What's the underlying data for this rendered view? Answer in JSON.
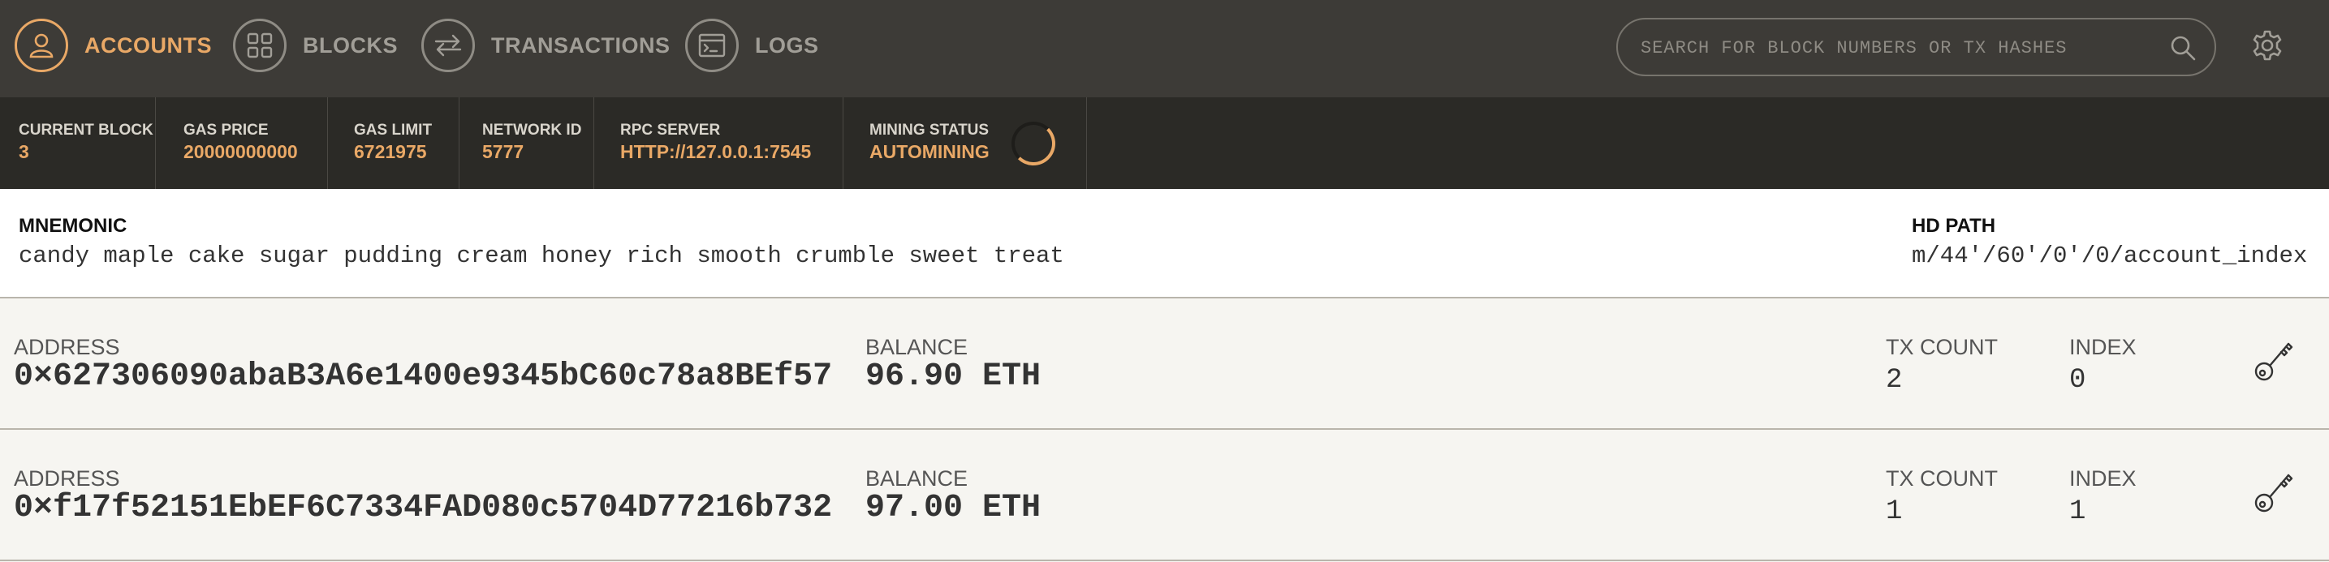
{
  "colors": {
    "accent": "#e9a866",
    "topbar": "#3d3b37",
    "statusbar": "#2b2a26",
    "background": "#f6f5f1"
  },
  "nav": [
    {
      "label": "ACCOUNTS",
      "icon": "person-icon",
      "active": true
    },
    {
      "label": "BLOCKS",
      "icon": "grid-icon",
      "active": false
    },
    {
      "label": "TRANSACTIONS",
      "icon": "arrows-swap-icon",
      "active": false
    },
    {
      "label": "LOGS",
      "icon": "terminal-icon",
      "active": false
    }
  ],
  "search": {
    "placeholder": "SEARCH FOR BLOCK NUMBERS OR TX HASHES",
    "value": ""
  },
  "status": {
    "current_block": {
      "label": "CURRENT BLOCK",
      "value": "3"
    },
    "gas_price": {
      "label": "GAS PRICE",
      "value": "20000000000"
    },
    "gas_limit": {
      "label": "GAS LIMIT",
      "value": "6721975"
    },
    "network_id": {
      "label": "NETWORK ID",
      "value": "5777"
    },
    "rpc_server": {
      "label": "RPC SERVER",
      "value": "HTTP://127.0.0.1:7545"
    },
    "mining_status": {
      "label": "MINING STATUS",
      "value": "AUTOMINING"
    }
  },
  "mnemonic": {
    "label": "MNEMONIC",
    "value": "candy maple cake sugar pudding cream honey rich smooth crumble sweet treat",
    "hd_path_label": "HD PATH",
    "hd_path_value": "m/44'/60'/0'/0/account_index"
  },
  "accounts": [
    {
      "address_label": "ADDRESS",
      "address": "0×627306090abaB3A6e1400e9345bC60c78a8BEf57",
      "balance_label": "BALANCE",
      "balance": "96.90 ETH",
      "tx_count_label": "TX COUNT",
      "tx_count": "2",
      "index_label": "INDEX",
      "index": "0"
    },
    {
      "address_label": "ADDRESS",
      "address": "0×f17f52151EbEF6C7334FAD080c5704D77216b732",
      "balance_label": "BALANCE",
      "balance": "97.00 ETH",
      "tx_count_label": "TX COUNT",
      "tx_count": "1",
      "index_label": "INDEX",
      "index": "1"
    }
  ]
}
